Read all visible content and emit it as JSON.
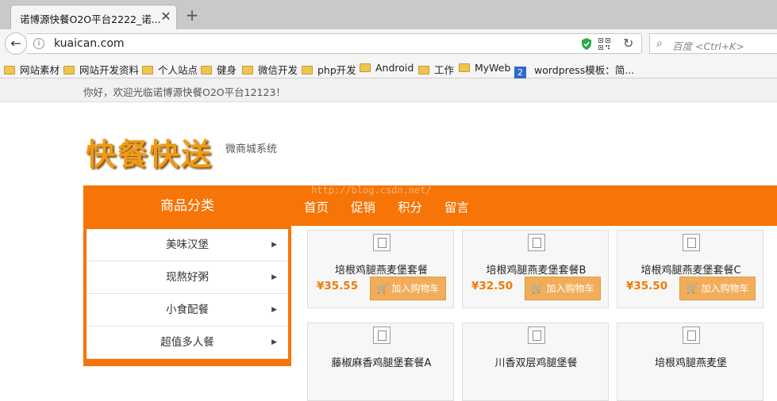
{
  "browser": {
    "tab_title": "诺博源快餐O2O平台2222_诺...",
    "tab_close": "✕",
    "new_tab": "+",
    "url": "kuaican.com",
    "search_placeholder": "百度 <Ctrl+K>",
    "bookmarks": [
      "网站素材",
      "网站开发资料",
      "个人站点",
      "健身",
      "微信开发",
      "php开发",
      "Android",
      "工作",
      "MyWeb"
    ],
    "bookmark_special_badge": "2",
    "bookmark_special": "wordpress模板：简..."
  },
  "page": {
    "welcome": "你好，欢迎光临诺博源快餐O2O平台12123！",
    "logo_text": "快餐快送",
    "logo_sub": "微商城系统",
    "watermark": "http://blog.csdn.net/",
    "category_header": "商品分类",
    "nav": [
      "首页",
      "促销",
      "积分",
      "留言"
    ],
    "categories": [
      "美味汉堡",
      "现熬好粥",
      "小食配餐",
      "超值多人餐"
    ],
    "cart_label": "加入购物车",
    "products": [
      {
        "name": "培根鸡腿燕麦堡套餐",
        "price": "¥35.55"
      },
      {
        "name": "培根鸡腿燕麦堡套餐B",
        "price": "¥32.50"
      },
      {
        "name": "培根鸡腿燕麦堡套餐C",
        "price": "¥35.50"
      },
      {
        "name": "藤椒麻香鸡腿堡套餐A",
        "price": ""
      },
      {
        "name": "川香双层鸡腿堡餐",
        "price": ""
      },
      {
        "name": "培根鸡腿燕麦堡",
        "price": ""
      }
    ]
  },
  "colors": {
    "accent": "#f77407",
    "price": "#f07a00",
    "cart_button": "#f1ad5a"
  }
}
